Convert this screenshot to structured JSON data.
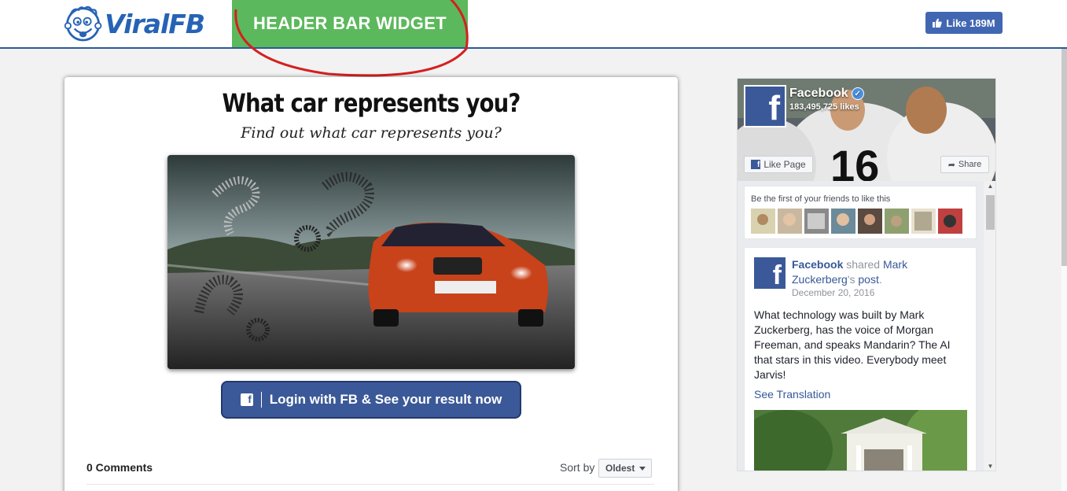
{
  "header": {
    "logo_text": "ViralFB",
    "widget_label": "HEADER BAR WIDGET",
    "like_button": {
      "label": "Like 189M"
    }
  },
  "quiz": {
    "title": "What car represents you?",
    "subtitle": "Find out what car represents you?",
    "login_button": "Login with FB & See your result now"
  },
  "comments": {
    "count_label": "0 Comments",
    "sort_label": "Sort by",
    "sort_value": "Oldest"
  },
  "fb_plugin": {
    "page_name": "Facebook",
    "likes": "183,495,725 likes",
    "like_page_label": "Like Page",
    "share_label": "Share",
    "friends_text": "Be the first of your friends to like this",
    "post": {
      "author": "Facebook",
      "shared": "shared",
      "owner_link": "Mark Zuckerberg",
      "owner_suffix": "'s",
      "post_link": "post",
      "date": "December 20, 2016",
      "body": "What technology was built by Mark Zuckerberg, has the voice of Morgan Freeman, and speaks Mandarin? The AI that stars in this video. Everybody meet Jarvis!",
      "see_translation": "See Translation"
    }
  },
  "colors": {
    "brand_blue": "#2663b5",
    "widget_green": "#5cb85c",
    "fb_blue": "#3b5998",
    "circle_red": "#d42020"
  }
}
